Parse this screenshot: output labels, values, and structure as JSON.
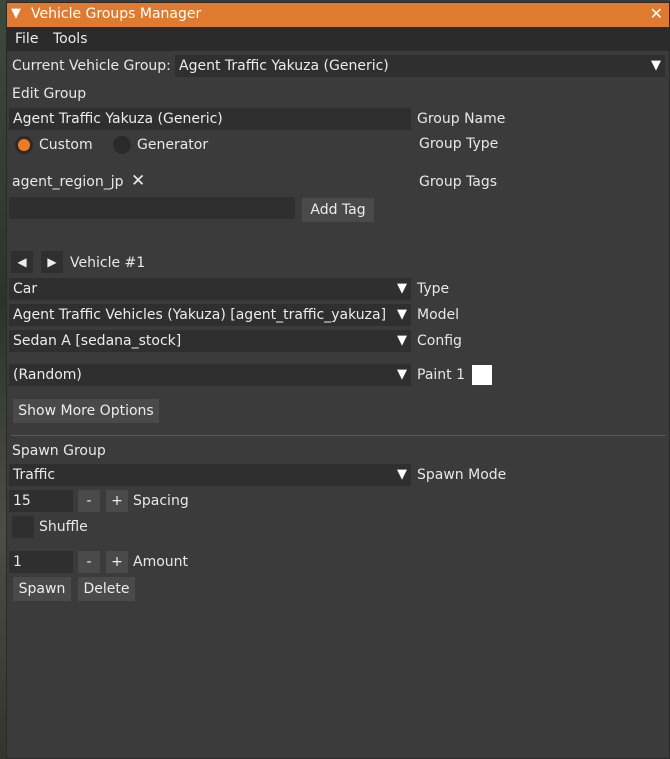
{
  "window": {
    "title": "Vehicle Groups Manager"
  },
  "menu": {
    "file": "File",
    "tools": "Tools"
  },
  "current_group": {
    "label": "Current Vehicle Group:",
    "value": "Agent Traffic Yakuza (Generic)"
  },
  "edit_group": {
    "header": "Edit Group",
    "name_value": "Agent Traffic Yakuza (Generic)",
    "name_label": "Group Name",
    "type_custom": "Custom",
    "type_generator": "Generator",
    "type_label": "Group Type",
    "tag": "agent_region_jp",
    "tags_label": "Group Tags",
    "tag_input": "",
    "add_tag": "Add Tag"
  },
  "vehicle": {
    "label": "Vehicle #1",
    "type_value": "Car",
    "type_label": "Type",
    "model_value": "Agent Traffic Vehicles (Yakuza) [agent_traffic_yakuza]",
    "model_label": "Model",
    "config_value": "Sedan A [sedana_stock]",
    "config_label": "Config",
    "paint_value": "(Random)",
    "paint_label": "Paint 1",
    "paint_color": "#ffffff",
    "more_options": "Show More Options"
  },
  "spawn": {
    "header": "Spawn Group",
    "mode_value": "Traffic",
    "mode_label": "Spawn Mode",
    "spacing_value": "15",
    "spacing_label": "Spacing",
    "shuffle_label": "Shuffle",
    "amount_value": "1",
    "amount_label": "Amount",
    "minus": "-",
    "plus": "+",
    "spawn_button": "Spawn",
    "delete_button": "Delete"
  },
  "colors": {
    "accent": "#e07a2e",
    "radio_on": "#f07a1e",
    "bg": "#3b3b3b",
    "field": "#2f2f2f"
  }
}
